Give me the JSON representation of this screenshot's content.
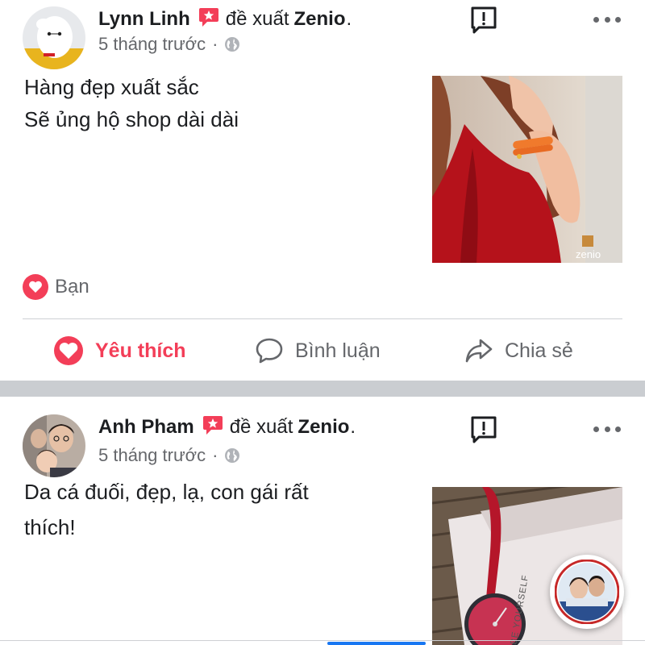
{
  "posts": [
    {
      "author": "Lynn Linh",
      "recommends_text": "đề xuất",
      "page_name": "Zenio",
      "trailing_dot": ".",
      "time": "5 tháng trước",
      "meta_sep": "·",
      "text_lines": [
        "Hàng đẹp xuất sắc",
        "Sẽ ủng hộ shop dài dài"
      ],
      "photo_watermark": "zenio",
      "reaction_label": "Bạn"
    },
    {
      "author": "Anh Pham",
      "recommends_text": "đề xuất",
      "page_name": "Zenio",
      "trailing_dot": ".",
      "time": "5 tháng trước",
      "meta_sep": "·",
      "text_lines": [
        "Da cá đuối, đẹp, lạ, con gái rất",
        "thích!"
      ],
      "photo_caption": "BE YOURSELF"
    }
  ],
  "actions": {
    "like": "Yêu thích",
    "comment": "Bình luận",
    "share": "Chia sẻ"
  },
  "icons": {
    "recommend": "recommend-star-icon",
    "report": "report-exclamation-icon",
    "more": "more-dots-icon",
    "globe": "globe-icon",
    "heart": "heart-icon",
    "comment": "comment-icon",
    "share": "share-icon"
  },
  "colors": {
    "accent_red": "#f33e58",
    "text_primary": "#1c1e21",
    "text_secondary": "#65676b",
    "separator": "#cacdd1",
    "tab_indicator": "#1877f2"
  }
}
